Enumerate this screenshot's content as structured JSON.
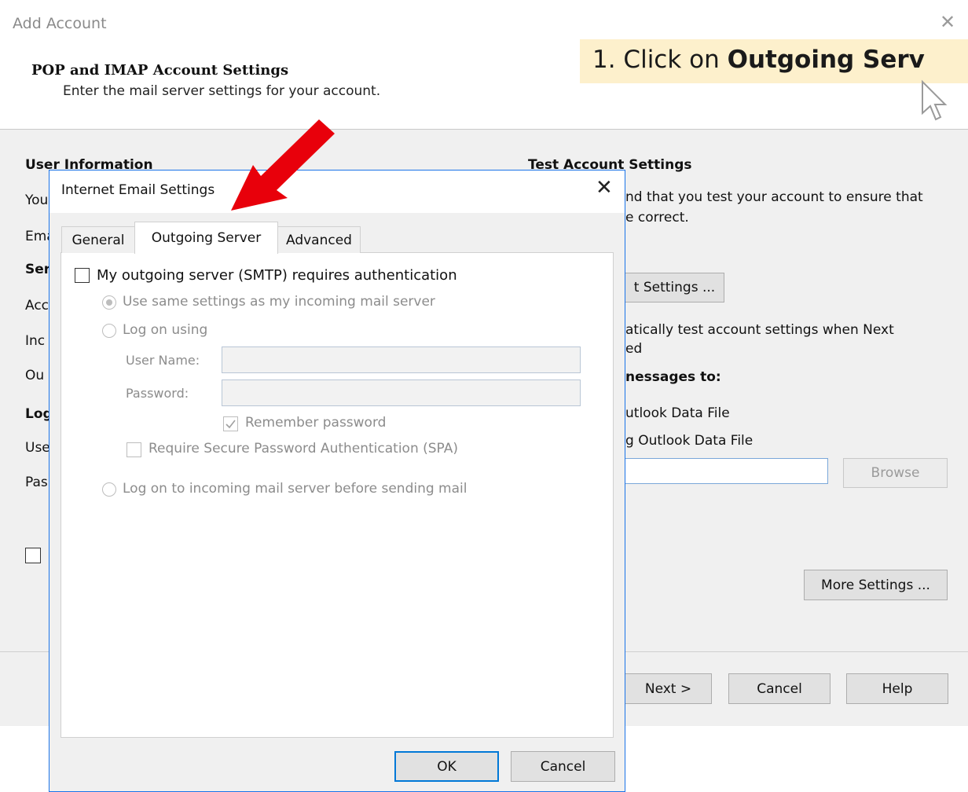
{
  "outer": {
    "title": "Add Account",
    "close_glyph": "✕",
    "section_title": "POP and IMAP Account Settings",
    "section_subtitle": "Enter the mail server settings for your account."
  },
  "callout": {
    "prefix": "1. Click on ",
    "bold": "Outgoing Serv"
  },
  "background": {
    "user_info_heading": "User Information",
    "left_fragments": [
      "You",
      "Ema",
      "Ser",
      "Acc",
      "Inc",
      "Ou",
      "Log",
      "Use",
      "Pas"
    ],
    "test_heading": "Test Account Settings",
    "test_text_line1": "nd that you test your account to ensure that",
    "test_text_line2": "e correct.",
    "test_settings_button": "t Settings ...",
    "auto_test_line1": "atically test account settings when Next",
    "auto_test_line2": "ed",
    "deliver_heading": "nessages to:",
    "new_data_file": "utlook Data File",
    "existing_data_file": "g Outlook Data File",
    "browse_button": "Browse",
    "more_settings_button": "More Settings ...",
    "next_button": "Next >",
    "cancel_button": "Cancel",
    "help_button": "Help"
  },
  "dialog": {
    "title": "Internet Email Settings",
    "close_glyph": "✕",
    "tabs": [
      {
        "label": "General"
      },
      {
        "label": "Outgoing Server"
      },
      {
        "label": "Advanced"
      }
    ],
    "smtp_auth_label": "My outgoing server (SMTP) requires authentication",
    "same_settings_label": "Use same settings as my incoming mail server",
    "log_on_using_label": "Log on using",
    "username_label": "User Name:",
    "username_value": "",
    "password_label": "Password:",
    "password_value": "",
    "remember_password_label": "Remember password",
    "spa_label": "Require Secure Password Authentication (SPA)",
    "log_on_incoming_label": "Log on to incoming mail server before sending mail",
    "ok_button": "OK",
    "cancel_button": "Cancel"
  },
  "colors": {
    "annotation_arrow": "#e8000b",
    "callout_bg": "#fdf0cc",
    "dialog_border": "#1a73e8",
    "ok_focus": "#0078d7"
  }
}
